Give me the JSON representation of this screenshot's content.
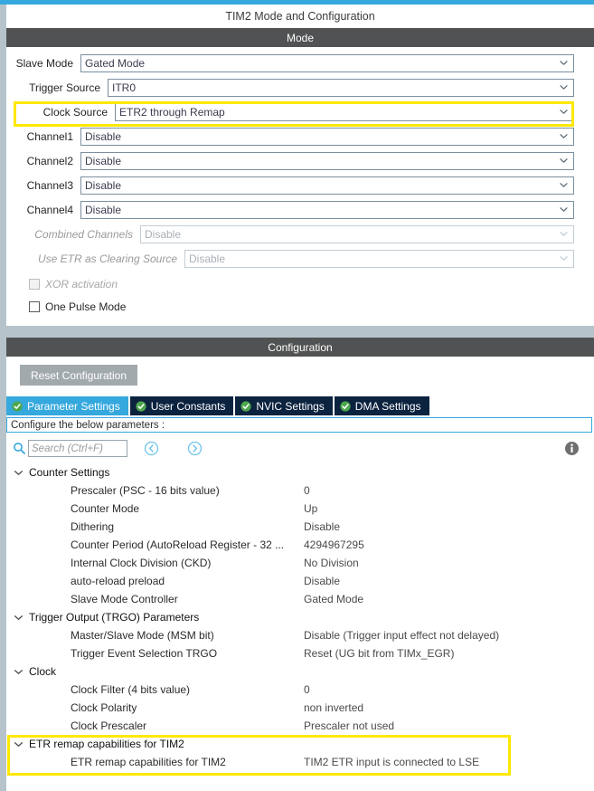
{
  "window": {
    "title": "TIM2 Mode and Configuration"
  },
  "colors": {
    "accent": "#35a8dd",
    "header_bar": "#515253",
    "tab_inactive": "#0c2340",
    "tab_active": "#35a8dd",
    "highlight": "#ffe800",
    "left_strip": "#b6c3cb",
    "reset_button": "#a2a9ad",
    "check_green": "#4ca64c"
  },
  "mode": {
    "header": "Mode",
    "fields": [
      {
        "label": "Slave Mode",
        "value": "Gated Mode",
        "disabled": false,
        "highlighted": false,
        "icon": "chevron-down-icon"
      },
      {
        "label": "Trigger Source",
        "value": "ITR0",
        "disabled": false,
        "highlighted": false,
        "icon": "chevron-down-icon"
      },
      {
        "label": "Clock Source",
        "value": "ETR2 through Remap",
        "disabled": false,
        "highlighted": true,
        "icon": "chevron-down-icon"
      },
      {
        "label": "Channel1",
        "value": "Disable",
        "disabled": false,
        "highlighted": false,
        "icon": "chevron-down-icon"
      },
      {
        "label": "Channel2",
        "value": "Disable",
        "disabled": false,
        "highlighted": false,
        "icon": "chevron-down-icon"
      },
      {
        "label": "Channel3",
        "value": "Disable",
        "disabled": false,
        "highlighted": false,
        "icon": "chevron-down-icon"
      },
      {
        "label": "Channel4",
        "value": "Disable",
        "disabled": false,
        "highlighted": false,
        "icon": "chevron-down-icon"
      },
      {
        "label": "Combined Channels",
        "value": "Disable",
        "disabled": true,
        "highlighted": false,
        "icon": "chevron-down-icon"
      },
      {
        "label": "Use ETR as Clearing Source",
        "value": "Disable",
        "disabled": true,
        "highlighted": false,
        "icon": "chevron-down-icon"
      }
    ],
    "checkboxes": [
      {
        "label": "XOR activation",
        "checked": false,
        "disabled": true
      },
      {
        "label": "One Pulse Mode",
        "checked": false,
        "disabled": false
      }
    ]
  },
  "configuration": {
    "header": "Configuration",
    "reset_button": "Reset Configuration",
    "tabs": [
      {
        "label": "Parameter Settings",
        "active": true,
        "icon": "check-circle-icon"
      },
      {
        "label": "User Constants",
        "active": false,
        "icon": "check-circle-icon"
      },
      {
        "label": "NVIC Settings",
        "active": false,
        "icon": "check-circle-icon"
      },
      {
        "label": "DMA Settings",
        "active": false,
        "icon": "check-circle-icon"
      }
    ],
    "configure_strip": "Configure the below parameters :",
    "search": {
      "placeholder": "Search (Ctrl+F)",
      "value": "",
      "icon": "search-icon",
      "prev_icon": "chevron-left-circle-icon",
      "next_icon": "chevron-right-circle-icon",
      "info_icon": "info-icon"
    },
    "tree": [
      {
        "group": "Counter Settings",
        "expanded": true,
        "highlighted": false,
        "items": [
          {
            "name": "Prescaler (PSC - 16 bits value)",
            "value": "0"
          },
          {
            "name": "Counter Mode",
            "value": "Up"
          },
          {
            "name": "Dithering",
            "value": "Disable"
          },
          {
            "name": "Counter Period (AutoReload Register - 32 ...",
            "value": "4294967295"
          },
          {
            "name": "Internal Clock Division (CKD)",
            "value": "No Division"
          },
          {
            "name": "auto-reload preload",
            "value": "Disable"
          },
          {
            "name": "Slave Mode Controller",
            "value": "Gated Mode"
          }
        ]
      },
      {
        "group": "Trigger Output (TRGO) Parameters",
        "expanded": true,
        "highlighted": false,
        "items": [
          {
            "name": "Master/Slave Mode (MSM bit)",
            "value": "Disable (Trigger input effect not delayed)"
          },
          {
            "name": "Trigger Event Selection TRGO",
            "value": "Reset (UG bit from TIMx_EGR)"
          }
        ]
      },
      {
        "group": "Clock",
        "expanded": true,
        "highlighted": false,
        "items": [
          {
            "name": "Clock Filter (4 bits value)",
            "value": "0"
          },
          {
            "name": "Clock Polarity",
            "value": "non inverted"
          },
          {
            "name": "Clock Prescaler",
            "value": "Prescaler not used"
          }
        ]
      },
      {
        "group": "ETR remap capabilities for TIM2",
        "expanded": true,
        "highlighted": true,
        "items": [
          {
            "name": "ETR remap capabilities for TIM2",
            "value": "TIM2 ETR input is connected to LSE"
          }
        ]
      }
    ]
  }
}
